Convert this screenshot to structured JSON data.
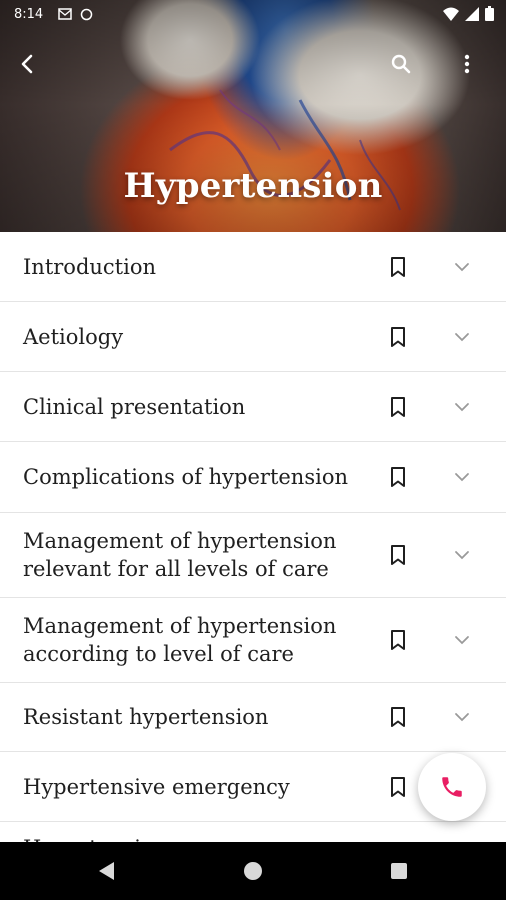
{
  "status_bar": {
    "time": "8:14",
    "left_icons": [
      "mail-icon",
      "sync-icon"
    ],
    "right_icons": [
      "wifi-icon",
      "signal-icon",
      "battery-icon"
    ]
  },
  "header": {
    "title": "Hypertension",
    "back_icon": "back-arrow-icon",
    "search_icon": "search-icon",
    "more_icon": "more-vert-icon"
  },
  "sections": [
    {
      "label": "Introduction"
    },
    {
      "label": "Aetiology"
    },
    {
      "label": "Clinical presentation"
    },
    {
      "label": "Complications of hypertension"
    },
    {
      "label": "Management of hypertension relevant for all levels of care"
    },
    {
      "label": "Management of hypertension according to level of care"
    },
    {
      "label": "Resistant hypertension"
    },
    {
      "label": "Hypertensive emergency"
    },
    {
      "label": "Hypertensive urgency"
    }
  ],
  "fab": {
    "icon": "phone-icon",
    "color": "#e91e63"
  },
  "colors": {
    "accent": "#e91e63",
    "divider": "#e4e4e4",
    "text": "#1f1f1f"
  }
}
